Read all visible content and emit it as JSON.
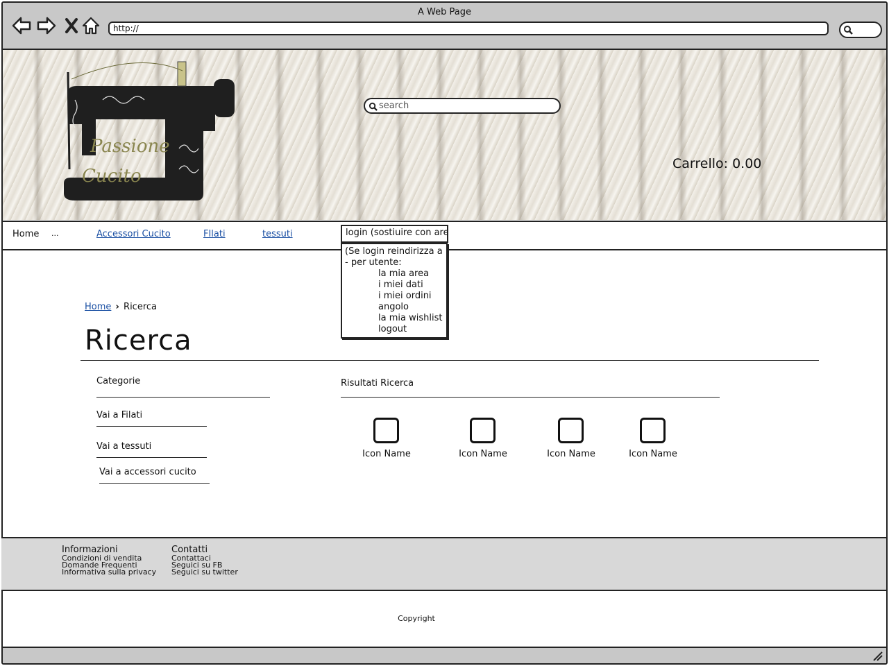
{
  "window": {
    "title": "A Web Page"
  },
  "browser": {
    "url": "http://"
  },
  "banner": {
    "logo_text_line1": "Passione",
    "logo_text_line2": "Cucito",
    "search_placeholder": "search",
    "cart_label": "Carrello: 0.00"
  },
  "nav": {
    "home": "Home",
    "ellipsis": "...",
    "accessori": "Accessori Cucito",
    "filati": "FIlati",
    "tessuti": "tessuti",
    "login_select": "login (sostiuire con area per utente)"
  },
  "dropdown": {
    "items": [
      "(Se login reindirizza a",
      "- per utente:",
      "la mia area",
      "i miei dati",
      "i miei ordini",
      "angolo",
      "la mia wishlist",
      "logout"
    ]
  },
  "breadcrumb": {
    "home": "Home",
    "current": "Ricerca"
  },
  "page": {
    "title": "Ricerca"
  },
  "sidebar": {
    "heading": "Categorie",
    "items": [
      "Vai a Filati",
      "Vai a tessuti",
      "Vai a accessori cucito"
    ]
  },
  "results": {
    "heading": "Risultati Ricerca",
    "icons": [
      "Icon Name",
      "Icon Name",
      "Icon Name",
      "Icon Name"
    ]
  },
  "footer": {
    "info_title": "Informazioni",
    "info_items": [
      "Condizioni di vendita",
      "Domande Frequenti",
      "Informativa sulla privacy"
    ],
    "contact_title": "Contatti",
    "contact_items": [
      "Contattaci",
      "Seguici su FB",
      "Seguici su twitter"
    ],
    "copyright": "Copyright"
  }
}
